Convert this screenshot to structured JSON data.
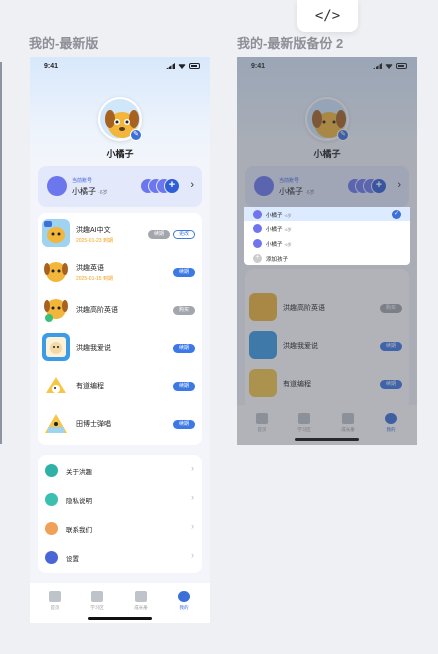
{
  "chip": {
    "label": "</>"
  },
  "frames": [
    {
      "label": "我的-最新版"
    },
    {
      "label": "我的-最新版备份 2"
    }
  ],
  "status": {
    "time": "9:41"
  },
  "profile": {
    "nickname": "小橘子"
  },
  "account": {
    "caption": "当前账号",
    "name": "小橘子",
    "age": "·6岁"
  },
  "courses": [
    {
      "title": "洪趣AI中文",
      "sub": "2025-01-23 到期",
      "buttons": [
        "续期",
        "更改"
      ],
      "button_styles": [
        "grey",
        "outline"
      ]
    },
    {
      "title": "洪趣英语",
      "sub": "2025-01-15 到期",
      "buttons": [
        "续期"
      ],
      "button_styles": [
        "blue"
      ]
    },
    {
      "title": "洪趣高阶英语",
      "buttons": [
        "购买"
      ],
      "button_styles": [
        "grey"
      ]
    },
    {
      "title": "洪趣我爱说",
      "buttons": [
        "续期"
      ],
      "button_styles": [
        "blue"
      ]
    },
    {
      "title": "有道编程",
      "buttons": [
        "续期"
      ],
      "button_styles": [
        "blue"
      ]
    },
    {
      "title": "田博士弹唱",
      "buttons": [
        "续期"
      ],
      "button_styles": [
        "blue"
      ]
    }
  ],
  "menu": [
    {
      "label": "关于洪趣",
      "color": "#2fb2a5"
    },
    {
      "label": "隐私说明",
      "color": "#3bbfb0"
    },
    {
      "label": "联系我们",
      "color": "#f0a057"
    },
    {
      "label": "设置",
      "color": "#4a66d6"
    }
  ],
  "tabs": [
    {
      "label": "首页"
    },
    {
      "label": "学习区"
    },
    {
      "label": "成长册"
    },
    {
      "label": "我的",
      "active": true
    }
  ],
  "switcher": {
    "options": [
      {
        "name": "小橘子",
        "age": "·6岁",
        "selected": true
      },
      {
        "name": "小橘子",
        "age": "·6岁"
      },
      {
        "name": "小橘子",
        "age": "·6岁"
      }
    ],
    "add_label": "添加孩子",
    "add_icon": "+",
    "check_icon": "✓"
  },
  "colors": {
    "accent": "#3c6fd8",
    "avatar": "#6c77ee"
  }
}
